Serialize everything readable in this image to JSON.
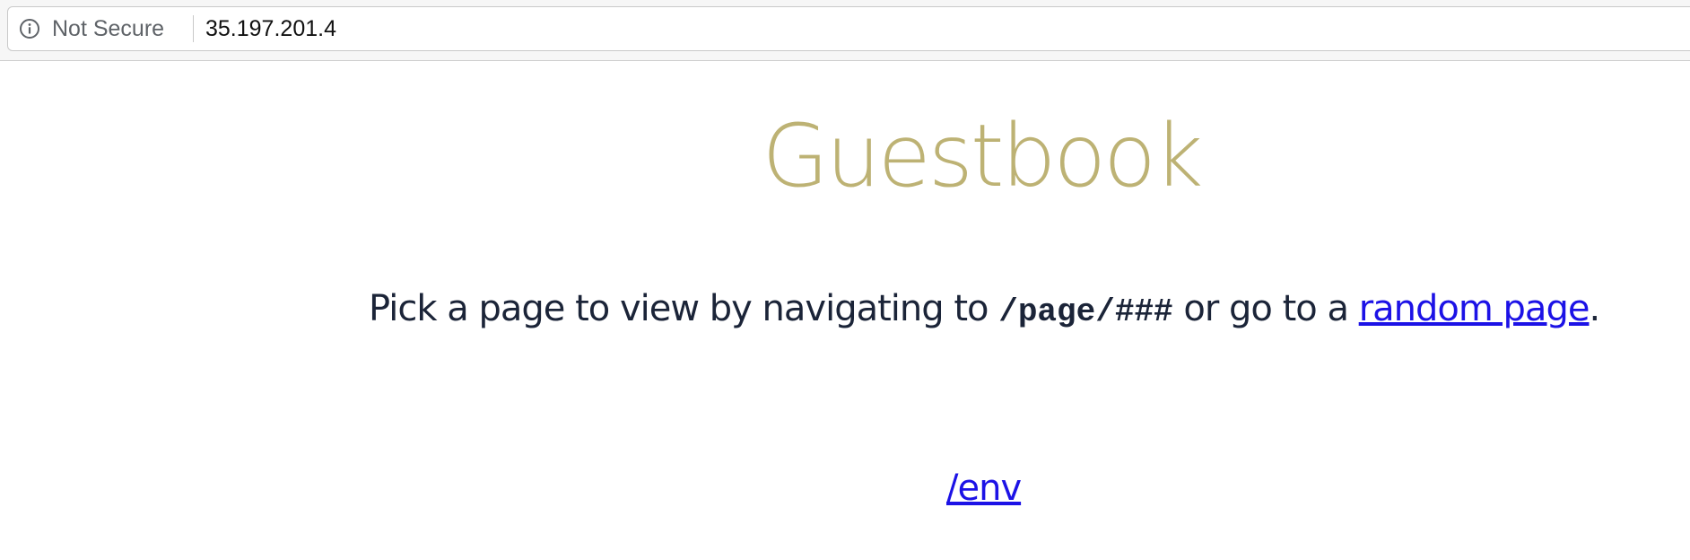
{
  "browser": {
    "security_label": "Not Secure",
    "url": "35.197.201.4",
    "security_icon": "info-icon"
  },
  "page": {
    "title": "Guestbook",
    "intro_before": "Pick a page to view by navigating to ",
    "intro_code": "/page/###",
    "intro_middle": " or go to a ",
    "random_link": "random page",
    "intro_end": ".",
    "env_link": "/env"
  },
  "colors": {
    "title": "#bdb274",
    "body_text": "#1b2438",
    "link": "#1c12e6"
  }
}
